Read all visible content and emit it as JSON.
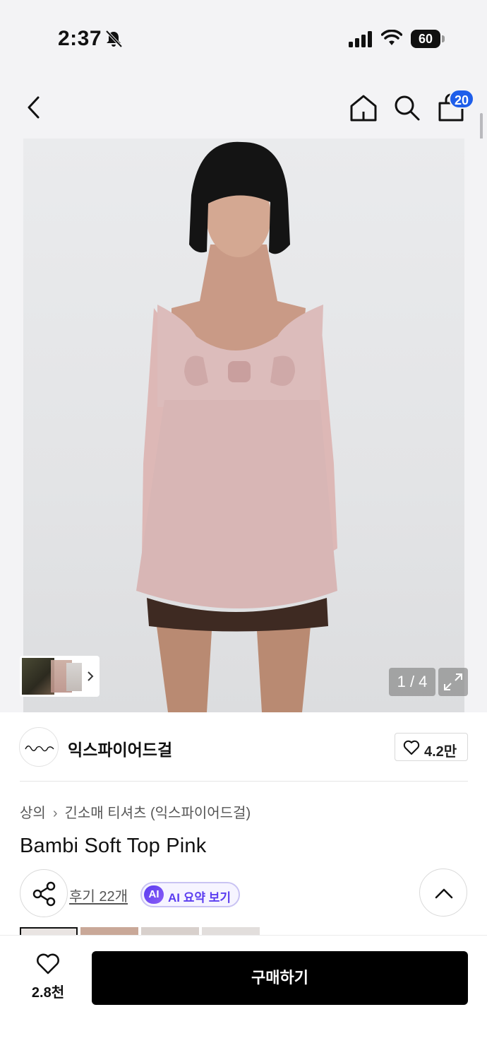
{
  "status_bar": {
    "time": "2:37",
    "battery": "60",
    "icons": [
      "bell-off-icon",
      "cellular-signal-icon",
      "wifi-icon",
      "battery-icon"
    ]
  },
  "header": {
    "icons": [
      "back-arrow-icon",
      "home-icon",
      "search-icon",
      "shopping-bag-icon"
    ],
    "cart_badge": "20"
  },
  "gallery": {
    "page_counter": "1 / 4",
    "current_page": 1,
    "total_pages": 4
  },
  "brand": {
    "name": "익스파이어드걸",
    "likes": "4.2만"
  },
  "product": {
    "breadcrumb": [
      "상의",
      "긴소매 티셔츠 (익스파이어드걸)"
    ],
    "title": "Bambi Soft Top Pink",
    "review_link": "후기 22개",
    "ai_badge": "AI",
    "ai_summary_label": "AI 요약 보기"
  },
  "bottom_bar": {
    "wish_count": "2.8천",
    "buy_label": "구매하기"
  },
  "colors": {
    "accent_blue": "#1e5eea",
    "ai_purple": "#5b3df0",
    "buy_button": "#000000",
    "background_gray": "#f3f3f5"
  }
}
